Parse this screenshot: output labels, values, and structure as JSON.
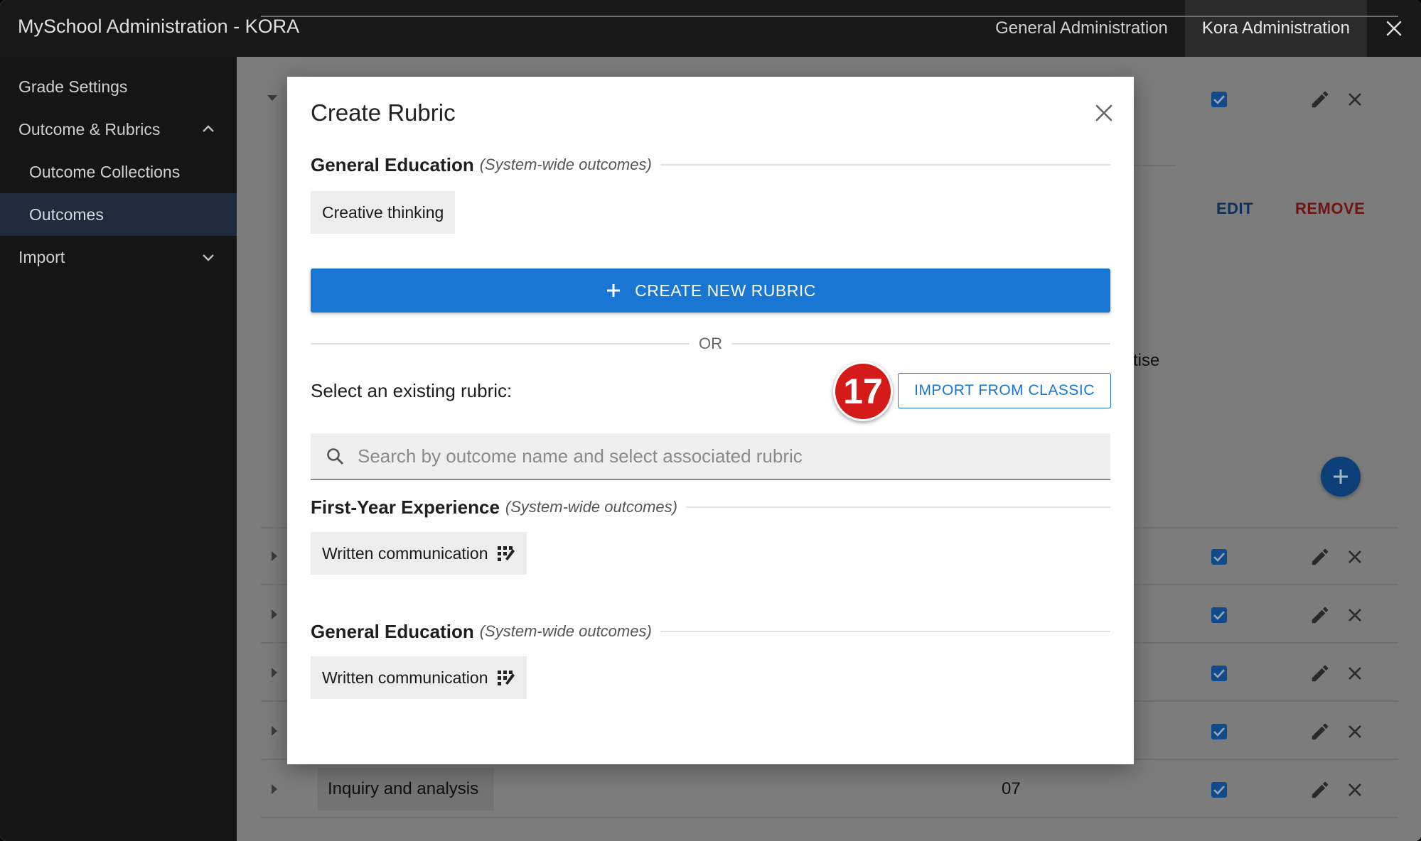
{
  "app": {
    "title": "MySchool Administration - KORA"
  },
  "topnav": {
    "tabs": [
      {
        "label": "General Administration",
        "active": false
      },
      {
        "label": "Kora Administration",
        "active": true
      }
    ]
  },
  "sidebar": {
    "items": [
      {
        "label": "Grade Settings"
      },
      {
        "label": "Outcome & Rubrics",
        "expanded": true
      },
      {
        "label": "Outcome Collections"
      },
      {
        "label": "Outcomes",
        "active": true
      },
      {
        "label": "Import",
        "expanded": false
      }
    ]
  },
  "background": {
    "edit_label": "EDIT",
    "remove_label": "REMOVE",
    "partial_text": "tise",
    "visible_row": {
      "name": "Inquiry and analysis",
      "code": "07"
    }
  },
  "modal": {
    "title": "Create Rubric",
    "current_section": {
      "name": "General Education",
      "note": "(System-wide outcomes)"
    },
    "current_outcome": "Creative thinking",
    "create_button": "CREATE NEW RUBRIC",
    "or_label": "OR",
    "select_label": "Select an existing rubric:",
    "step_badge": "17",
    "import_button": "IMPORT FROM CLASSIC",
    "search": {
      "placeholder": "Search by outcome name and select associated rubric",
      "value": ""
    },
    "results": [
      {
        "section": "First-Year Experience",
        "note": "(System-wide outcomes)",
        "outcome": "Written communication",
        "icon": "rubric-icon"
      },
      {
        "section": "General Education",
        "note": "(System-wide outcomes)",
        "outcome": "Written communication",
        "icon": "rubric-icon"
      }
    ]
  },
  "colors": {
    "primary": "#1976d2",
    "badge": "#d51a1a",
    "sidebar_active": "#1f2a3c"
  }
}
